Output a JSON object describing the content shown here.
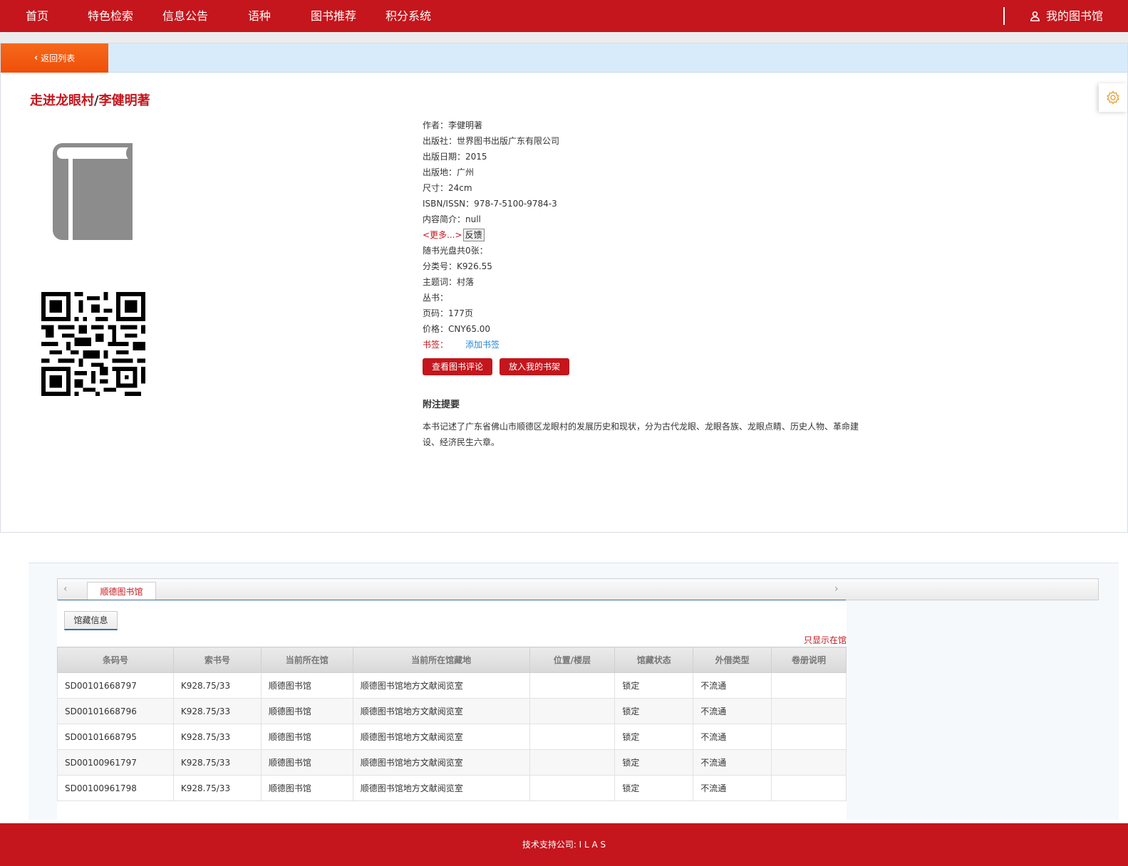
{
  "nav": {
    "items": [
      "首页",
      "特色检索",
      "信息公告",
      "语种",
      "图书推荐",
      "积分系统"
    ],
    "my_library": "我的图书馆"
  },
  "subbar": {
    "back_label": "返回列表"
  },
  "book": {
    "title": "走进龙眼村",
    "title_sep": "/",
    "title_author": "李健明著",
    "details": [
      {
        "label": "作者：",
        "value": "李健明著"
      },
      {
        "label": "出版社：",
        "value": "世界图书出版广东有限公司"
      },
      {
        "label": "出版日期：",
        "value": "2015"
      },
      {
        "label": "出版地：",
        "value": "广州"
      },
      {
        "label": "尺寸：",
        "value": "24cm"
      },
      {
        "label": "ISBN/ISSN：",
        "value": "978-7-5100-9784-3"
      },
      {
        "label": "内容简介：",
        "value": "null"
      }
    ],
    "more_label": "<更多...>",
    "feedback_label": "反馈",
    "details2": [
      {
        "label": "随书光盘共0张：",
        "value": ""
      },
      {
        "label": "分类号：",
        "value": "K926.55"
      },
      {
        "label": "主题词：",
        "value": "村落"
      },
      {
        "label": "丛书：",
        "value": ""
      },
      {
        "label": "页码：",
        "value": "177页"
      },
      {
        "label": "价格：",
        "value": "CNY65.00"
      }
    ],
    "bookmark_label": "书签：",
    "add_bookmark": "添加书签",
    "review_button": "查看图书评论",
    "shelf_button": "放入我的书架",
    "note_title": "附注提要",
    "note_text": "本书记述了广东省佛山市顺德区龙眼村的发展历史和现状，分为古代龙眼、龙眼各族、龙眼点睛、历史人物、革命建设、经济民生六章。"
  },
  "holdings": {
    "library_tab": "顺德图书馆",
    "info_tab": "馆藏信息",
    "only_available": "只显示在馆",
    "columns": [
      "条码号",
      "索书号",
      "当前所在馆",
      "当前所在馆藏地",
      "位置/楼层",
      "馆藏状态",
      "外借类型",
      "卷册说明"
    ],
    "rows": [
      [
        "SD00101668797",
        "K928.75/33",
        "顺德图书馆",
        "顺德图书馆地方文献阅览室",
        "",
        "锁定",
        "不流通",
        ""
      ],
      [
        "SD00101668796",
        "K928.75/33",
        "顺德图书馆",
        "顺德图书馆地方文献阅览室",
        "",
        "锁定",
        "不流通",
        ""
      ],
      [
        "SD00101668795",
        "K928.75/33",
        "顺德图书馆",
        "顺德图书馆地方文献阅览室",
        "",
        "锁定",
        "不流通",
        ""
      ],
      [
        "SD00100961797",
        "K928.75/33",
        "顺德图书馆",
        "顺德图书馆地方文献阅览室",
        "",
        "锁定",
        "不流通",
        ""
      ],
      [
        "SD00100961798",
        "K928.75/33",
        "顺德图书馆",
        "顺德图书馆地方文献阅览室",
        "",
        "锁定",
        "不流通",
        ""
      ]
    ]
  },
  "footer": {
    "text": "技术支持公司: I L A S"
  },
  "colors": {
    "brand_red": "#c4161c",
    "back_orange": "#f25a10",
    "subbar_blue": "#d7ebfb"
  },
  "icons": {
    "user": "user-icon",
    "back": "chevron-left-icon",
    "settings": "gear-icon",
    "book": "book-icon"
  }
}
